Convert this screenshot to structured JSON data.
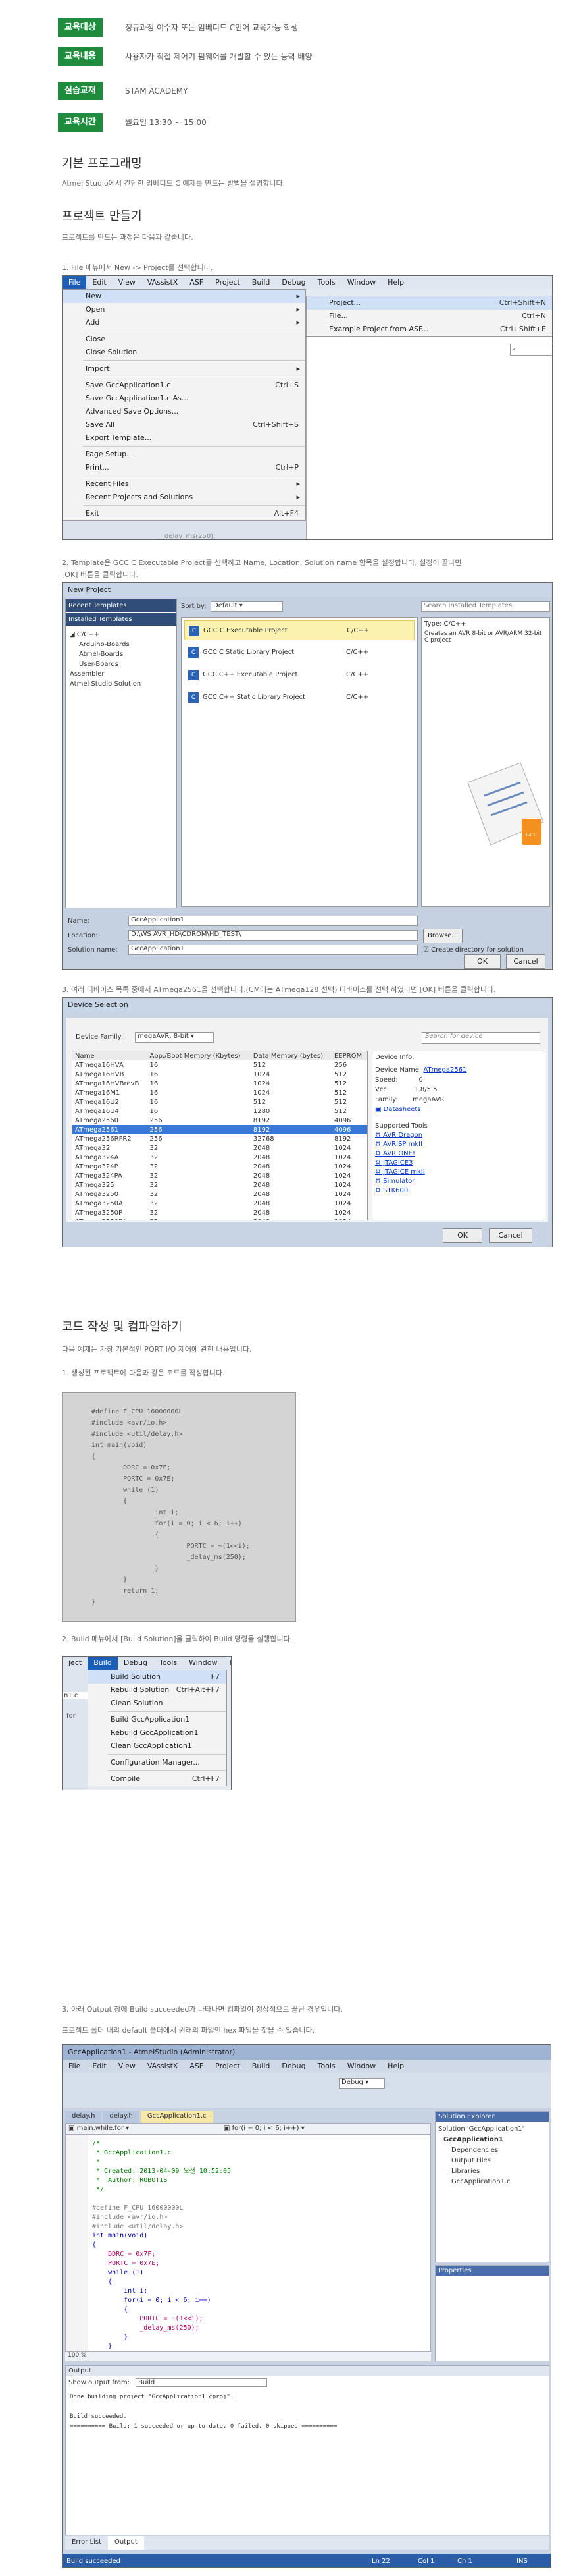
{
  "info": [
    {
      "tag": "교육대상",
      "text": "정규과정 이수자 또는 임베디드 C언어 교육가능 학생"
    },
    {
      "tag": "교육내용",
      "text": "사용자가 직접 제어기 펌웨어를 개발할 수 있는 능력 배양"
    },
    {
      "tag": "실습교재",
      "text": "STAM ACADEMY"
    },
    {
      "tag": "교육시간",
      "text": "월요일 13:30 ~ 15:00"
    }
  ],
  "sec1": {
    "title": "기본 프로그래밍",
    "desc": "Atmel Studio에서 간단한 임베디드 C 예제를 만드는 방법을 설명합니다."
  },
  "sec2": {
    "title": "프로젝트 만들기",
    "desc": "프로젝트를 만드는 과정은 다음과 같습니다."
  },
  "step1": "1. File 메뉴에서 New -> Project를 선택합니다.",
  "step2": "2. Template은 GCC C Executable Project를 선택하고 Name, Location, Solution name 항목을 설정합니다. 설정이 끝나면",
  "step2b": "[OK] 버튼을 클릭합니다.",
  "step3": "3. 여러 디바이스 목록 중에서 ATmega2561을 선택합니다.(CM에는 ATmega128 선택) 디바이스를 선택 하였다면 [OK] 버튼을 클릭합니다.",
  "sec3": {
    "title": "코드 작성 및 컴파일하기",
    "desc": "다음 예제는 가장 기본적인 PORT I/O 제어에 관한 내용입니다."
  },
  "step4": "1. 생성된 프로젝트에 다음과 같은 코드를 작성합니다.",
  "step5": "2. Build 메뉴에서 [Build Solution]을 클릭하여 Build 명령을 실행합니다.",
  "step6": "3. 아래 Output 창에 Build succeeded가 나타나면 컴파일이 정상적으로 끝난 경우입니다.",
  "step6b": "프로젝트 폴더 내의 default 폴더에서 원래의 파일인 hex 파일을 찾을 수 있습니다.",
  "shot1": {
    "menubar": [
      "File",
      "Edit",
      "View",
      "VAssistX",
      "ASF",
      "Project",
      "Build",
      "Debug",
      "Tools",
      "Window",
      "Help"
    ],
    "file_menu": [
      {
        "label": "New",
        "sc": "",
        "arrow": true
      },
      {
        "label": "Open",
        "sc": "",
        "arrow": true
      },
      {
        "label": "Add",
        "sc": "",
        "arrow": true
      },
      {
        "label": "Close",
        "sc": ""
      },
      {
        "label": "Close Solution",
        "sc": ""
      },
      {
        "label": "Import",
        "sc": "",
        "arrow": true
      },
      {
        "label": "Save GccApplication1.c",
        "sc": "Ctrl+S"
      },
      {
        "label": "Save GccApplication1.c As...",
        "sc": ""
      },
      {
        "label": "Advanced Save Options...",
        "sc": ""
      },
      {
        "label": "Save All",
        "sc": "Ctrl+Shift+S"
      },
      {
        "label": "Export Template...",
        "sc": ""
      },
      {
        "label": "Page Setup...",
        "sc": ""
      },
      {
        "label": "Print...",
        "sc": "Ctrl+P"
      },
      {
        "label": "Recent Files",
        "sc": "",
        "arrow": true
      },
      {
        "label": "Recent Projects and Solutions",
        "sc": "",
        "arrow": true
      },
      {
        "label": "Exit",
        "sc": "Alt+F4"
      }
    ],
    "new_menu": [
      {
        "label": "Project...",
        "sc": "Ctrl+Shift+N"
      },
      {
        "label": "File...",
        "sc": "Ctrl+N"
      },
      {
        "label": "Example Project from ASF...",
        "sc": "Ctrl+Shift+E"
      }
    ]
  },
  "shot2": {
    "title": "New Project",
    "recent": "Recent Templates",
    "installed": "Installed Templates",
    "tree": [
      "C/C++",
      "Arduino-Boards",
      "Atmel-Boards",
      "User-Boards",
      "Assembler",
      "Atmel Studio Solution"
    ],
    "sortby": "Sort by:",
    "sort_val": "Default",
    "search": "Search Installed Templates",
    "templates": [
      {
        "name": "GCC C Executable Project",
        "lang": "C/C++"
      },
      {
        "name": "GCC C Static Library Project",
        "lang": "C/C++"
      },
      {
        "name": "GCC C++ Executable Project",
        "lang": "C/C++"
      },
      {
        "name": "GCC C++ Static Library Project",
        "lang": "C/C++"
      }
    ],
    "type_label": "Type: C/C++",
    "type_desc": "Creates an AVR 8-bit or AVR/ARM 32-bit C project",
    "name_lbl": "Name:",
    "name_val": "GccApplication1",
    "loc_lbl": "Location:",
    "loc_val": "D:\\WS AVR_HD\\CDROM\\HD_TEST\\",
    "sol_lbl": "Solution name:",
    "sol_val": "GccApplication1",
    "browse": "Browse...",
    "create_dir": "Create directory for solution",
    "ok": "OK",
    "cancel": "Cancel"
  },
  "shot3": {
    "title": "Device Selection",
    "family_lbl": "Device Family:",
    "family_val": "megaAVR, 8-bit",
    "search": "Search for device",
    "headers": [
      "Name",
      "App./Boot Memory (Kbytes)",
      "Data Memory (bytes)",
      "EEPROM"
    ],
    "rows": [
      [
        "ATmega16HVA",
        "16",
        "512",
        "256"
      ],
      [
        "ATmega16HVB",
        "16",
        "1024",
        "512"
      ],
      [
        "ATmega16HVBrevB",
        "16",
        "1024",
        "512"
      ],
      [
        "ATmega16M1",
        "16",
        "1024",
        "512"
      ],
      [
        "ATmega16U2",
        "16",
        "512",
        "512"
      ],
      [
        "ATmega16U4",
        "16",
        "1280",
        "512"
      ],
      [
        "ATmega2560",
        "256",
        "8192",
        "4096"
      ],
      [
        "ATmega2561",
        "256",
        "8192",
        "4096"
      ],
      [
        "ATmega256RFR2",
        "256",
        "32768",
        "8192"
      ],
      [
        "ATmega32",
        "32",
        "2048",
        "1024"
      ],
      [
        "ATmega324A",
        "32",
        "2048",
        "1024"
      ],
      [
        "ATmega324P",
        "32",
        "2048",
        "1024"
      ],
      [
        "ATmega324PA",
        "32",
        "2048",
        "1024"
      ],
      [
        "ATmega325",
        "32",
        "2048",
        "1024"
      ],
      [
        "ATmega3250",
        "32",
        "2048",
        "1024"
      ],
      [
        "ATmega3250A",
        "32",
        "2048",
        "1024"
      ],
      [
        "ATmega3250P",
        "32",
        "2048",
        "1024"
      ],
      [
        "ATmega3250PA",
        "32",
        "2048",
        "1024"
      ]
    ],
    "info_title": "Device Info:",
    "dev_name_lbl": "Device Name:",
    "dev_name": "ATmega2561",
    "speed_lbl": "Speed:",
    "speed": "0",
    "vcc_lbl": "Vcc:",
    "vcc": "1.8/5.5",
    "fam_lbl": "Family:",
    "fam": "megaAVR",
    "datasheets": "Datasheets",
    "tools_title": "Supported Tools",
    "tools": [
      "AVR Dragon",
      "AVRISP mkII",
      "AVR ONE!",
      "JTAGICE3",
      "JTAGICE mkII",
      "Simulator",
      "STK600"
    ],
    "ok": "OK",
    "cancel": "Cancel"
  },
  "code1": "#define F_CPU 16000000L\n#include <avr/io.h>\n#include <util/delay.h>\nint main(void)\n{\n        DDRC = 0x7F;\n        PORTC = 0x7E;\n        while (1)\n        {\n                int i;\n                for(i = 0; i < 6; i++)\n                {\n                        PORTC = ~(1<<i);\n                        _delay_ms(250);\n                }\n        }\n        return 1;\n}",
  "shot4": {
    "menubar": [
      "ject",
      "Build",
      "Debug",
      "Tools",
      "Window",
      "Help"
    ],
    "items": [
      {
        "label": "Build Solution",
        "sc": "F7"
      },
      {
        "label": "Rebuild Solution",
        "sc": "Ctrl+Alt+F7"
      },
      {
        "label": "Clean Solution",
        "sc": ""
      },
      {
        "label": "Build GccApplication1",
        "sc": ""
      },
      {
        "label": "Rebuild GccApplication1",
        "sc": ""
      },
      {
        "label": "Clean GccApplication1",
        "sc": ""
      },
      {
        "label": "Configuration Manager...",
        "sc": ""
      },
      {
        "label": "Compile",
        "sc": "Ctrl+F7"
      }
    ],
    "side": [
      "n1.c",
      "for"
    ]
  },
  "shot5": {
    "title": "GccApplication1 - AtmelStudio (Administrator)",
    "menubar": [
      "File",
      "Edit",
      "View",
      "VAssistX",
      "ASF",
      "Project",
      "Build",
      "Debug",
      "Tools",
      "Window",
      "Help"
    ],
    "config": "Debug",
    "tabs": [
      "delay.h",
      "delay.h",
      "GccApplication1.c"
    ],
    "nav_left": "main.while.for",
    "nav_right": "for(i = 0; i < 6; i++)",
    "code_lines": [
      "/*",
      " * GccApplication1.c",
      " *",
      " * Created: 2013-04-09 오전 10:52:05",
      " *  Author: ROBOTIS",
      " */",
      "",
      "#define F_CPU 16000000L",
      "#include <avr/io.h>",
      "#include <util/delay.h>",
      "int main(void)",
      "{",
      "    DDRC = 0x7F;",
      "    PORTC = 0x7E;",
      "    while (1)",
      "    {",
      "        int i;",
      "        for(i = 0; i < 6; i++)",
      "        {",
      "            PORTC = ~(1<<i);",
      "            _delay_ms(250);",
      "        }",
      "    }"
    ],
    "zoom": "100 %",
    "sol_title": "Solution Explorer",
    "sol_items": [
      "Solution 'GccApplication1'",
      "GccApplication1",
      "Dependencies",
      "Output Files",
      "Libraries",
      "GccApplication1.c"
    ],
    "props": "Properties",
    "output_title": "Output",
    "output_from": "Show output from:",
    "output_src": "Build",
    "output_lines": [
      "Done building project \"GccApplication1.cproj\".",
      "",
      "Build succeeded.",
      "========== Build: 1 succeeded or up-to-date, 0 failed, 0 skipped =========="
    ],
    "bottom_tabs": [
      "Error List",
      "Output"
    ],
    "status": "Build succeeded",
    "ln": "Ln 22",
    "col": "Col 1",
    "ch": "Ch 1",
    "ins": "INS"
  }
}
